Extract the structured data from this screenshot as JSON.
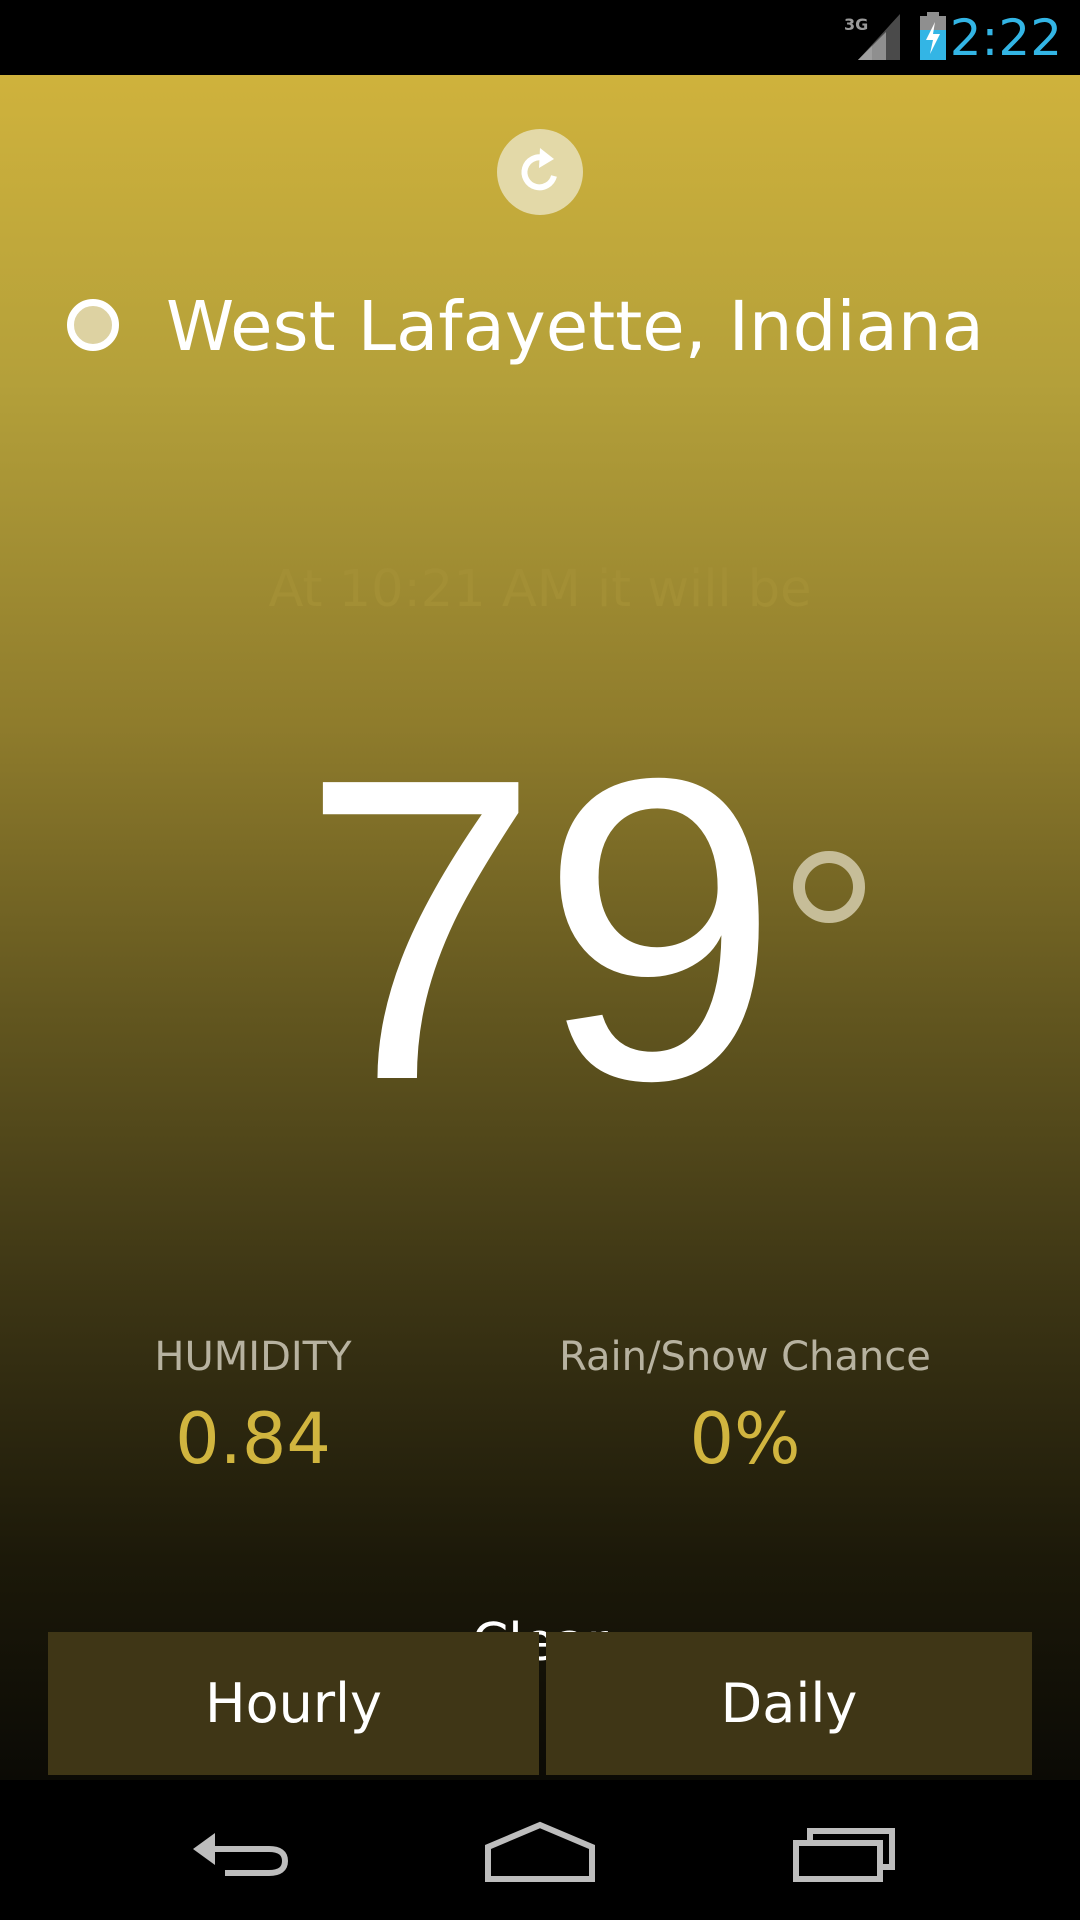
{
  "status_bar": {
    "network": "3G",
    "time": "2:22",
    "icons": [
      "signal-3g-icon",
      "battery-charging-icon"
    ],
    "time_color": "#33b5e5"
  },
  "app": {
    "refresh_icon": "refresh-icon",
    "location": "West Lafayette, Indiana",
    "forecast_time_text": "At 10:21 AM it will be",
    "temperature": "79",
    "stats": {
      "humidity_label": "HUMIDITY",
      "humidity_value": "0.84",
      "precip_label": "Rain/Snow Chance",
      "precip_value": "0%"
    },
    "summary": "Clear",
    "buttons": {
      "hourly": "Hourly",
      "daily": "Daily"
    },
    "colors": {
      "accent": "#d1b53f",
      "gradient_top": "#cfb23c",
      "gradient_bottom": "#0b0a05",
      "button_bg": "#3f3616"
    }
  },
  "nav_bar": {
    "icons": [
      "back-icon",
      "home-icon",
      "recents-icon"
    ]
  }
}
